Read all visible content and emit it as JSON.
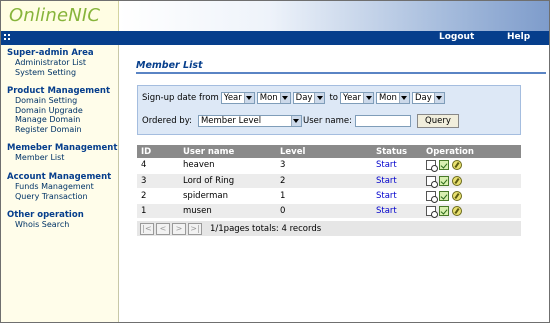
{
  "app": {
    "logo": "OnlineNIC"
  },
  "nav": {
    "logout": "Logout",
    "help": "Help"
  },
  "sidebar": {
    "groups": [
      {
        "title": "Super-admin Area",
        "items": [
          "Administrator List",
          "System Setting"
        ]
      },
      {
        "title": "Product Management",
        "items": [
          "Domain Setting",
          "Domain Upgrade",
          "Manage Domain",
          "Register Domain"
        ]
      },
      {
        "title": "Memeber Management",
        "items": [
          "Member List"
        ]
      },
      {
        "title": "Account Management",
        "items": [
          "Funds Management",
          "Query Transaction"
        ]
      },
      {
        "title": "Other operation",
        "items": [
          "Whois Search"
        ]
      }
    ]
  },
  "main": {
    "title": "Member List"
  },
  "filter": {
    "signup_label": "Sign-up date from",
    "from_year": "Year",
    "from_month": "Mon",
    "from_day": "Day",
    "to_label": "to",
    "to_year": "Year",
    "to_month": "Mon",
    "to_day": "Day",
    "ordered_label": "Ordered by:",
    "ordered_value": "Member Level",
    "username_label": "User name:",
    "username_value": "",
    "query_button": "Query"
  },
  "table": {
    "headers": [
      "ID",
      "User name",
      "Level",
      "Status",
      "Operation"
    ],
    "rows": [
      {
        "id": "4",
        "user": "heaven",
        "level": "3",
        "status": "Start"
      },
      {
        "id": "3",
        "user": "Lord of Ring",
        "level": "2",
        "status": "Start"
      },
      {
        "id": "2",
        "user": "spiderman",
        "level": "1",
        "status": "Start"
      },
      {
        "id": "1",
        "user": "musen",
        "level": "0",
        "status": "Start"
      }
    ]
  },
  "pager": {
    "first": "|<",
    "prev": "<",
    "next": ">",
    "last": ">|",
    "info": "1/1pages totals: 4 records"
  },
  "colors": {
    "nav_bg": "#063e8c",
    "sidebar_bg": "#fffdea",
    "logo": "#87b43b",
    "link": "#0000cc"
  },
  "icons": {
    "op_view": "view-doc-icon",
    "op_edit": "check-icon",
    "op_delete": "delete-icon",
    "nav_grip": "grip-icon"
  }
}
